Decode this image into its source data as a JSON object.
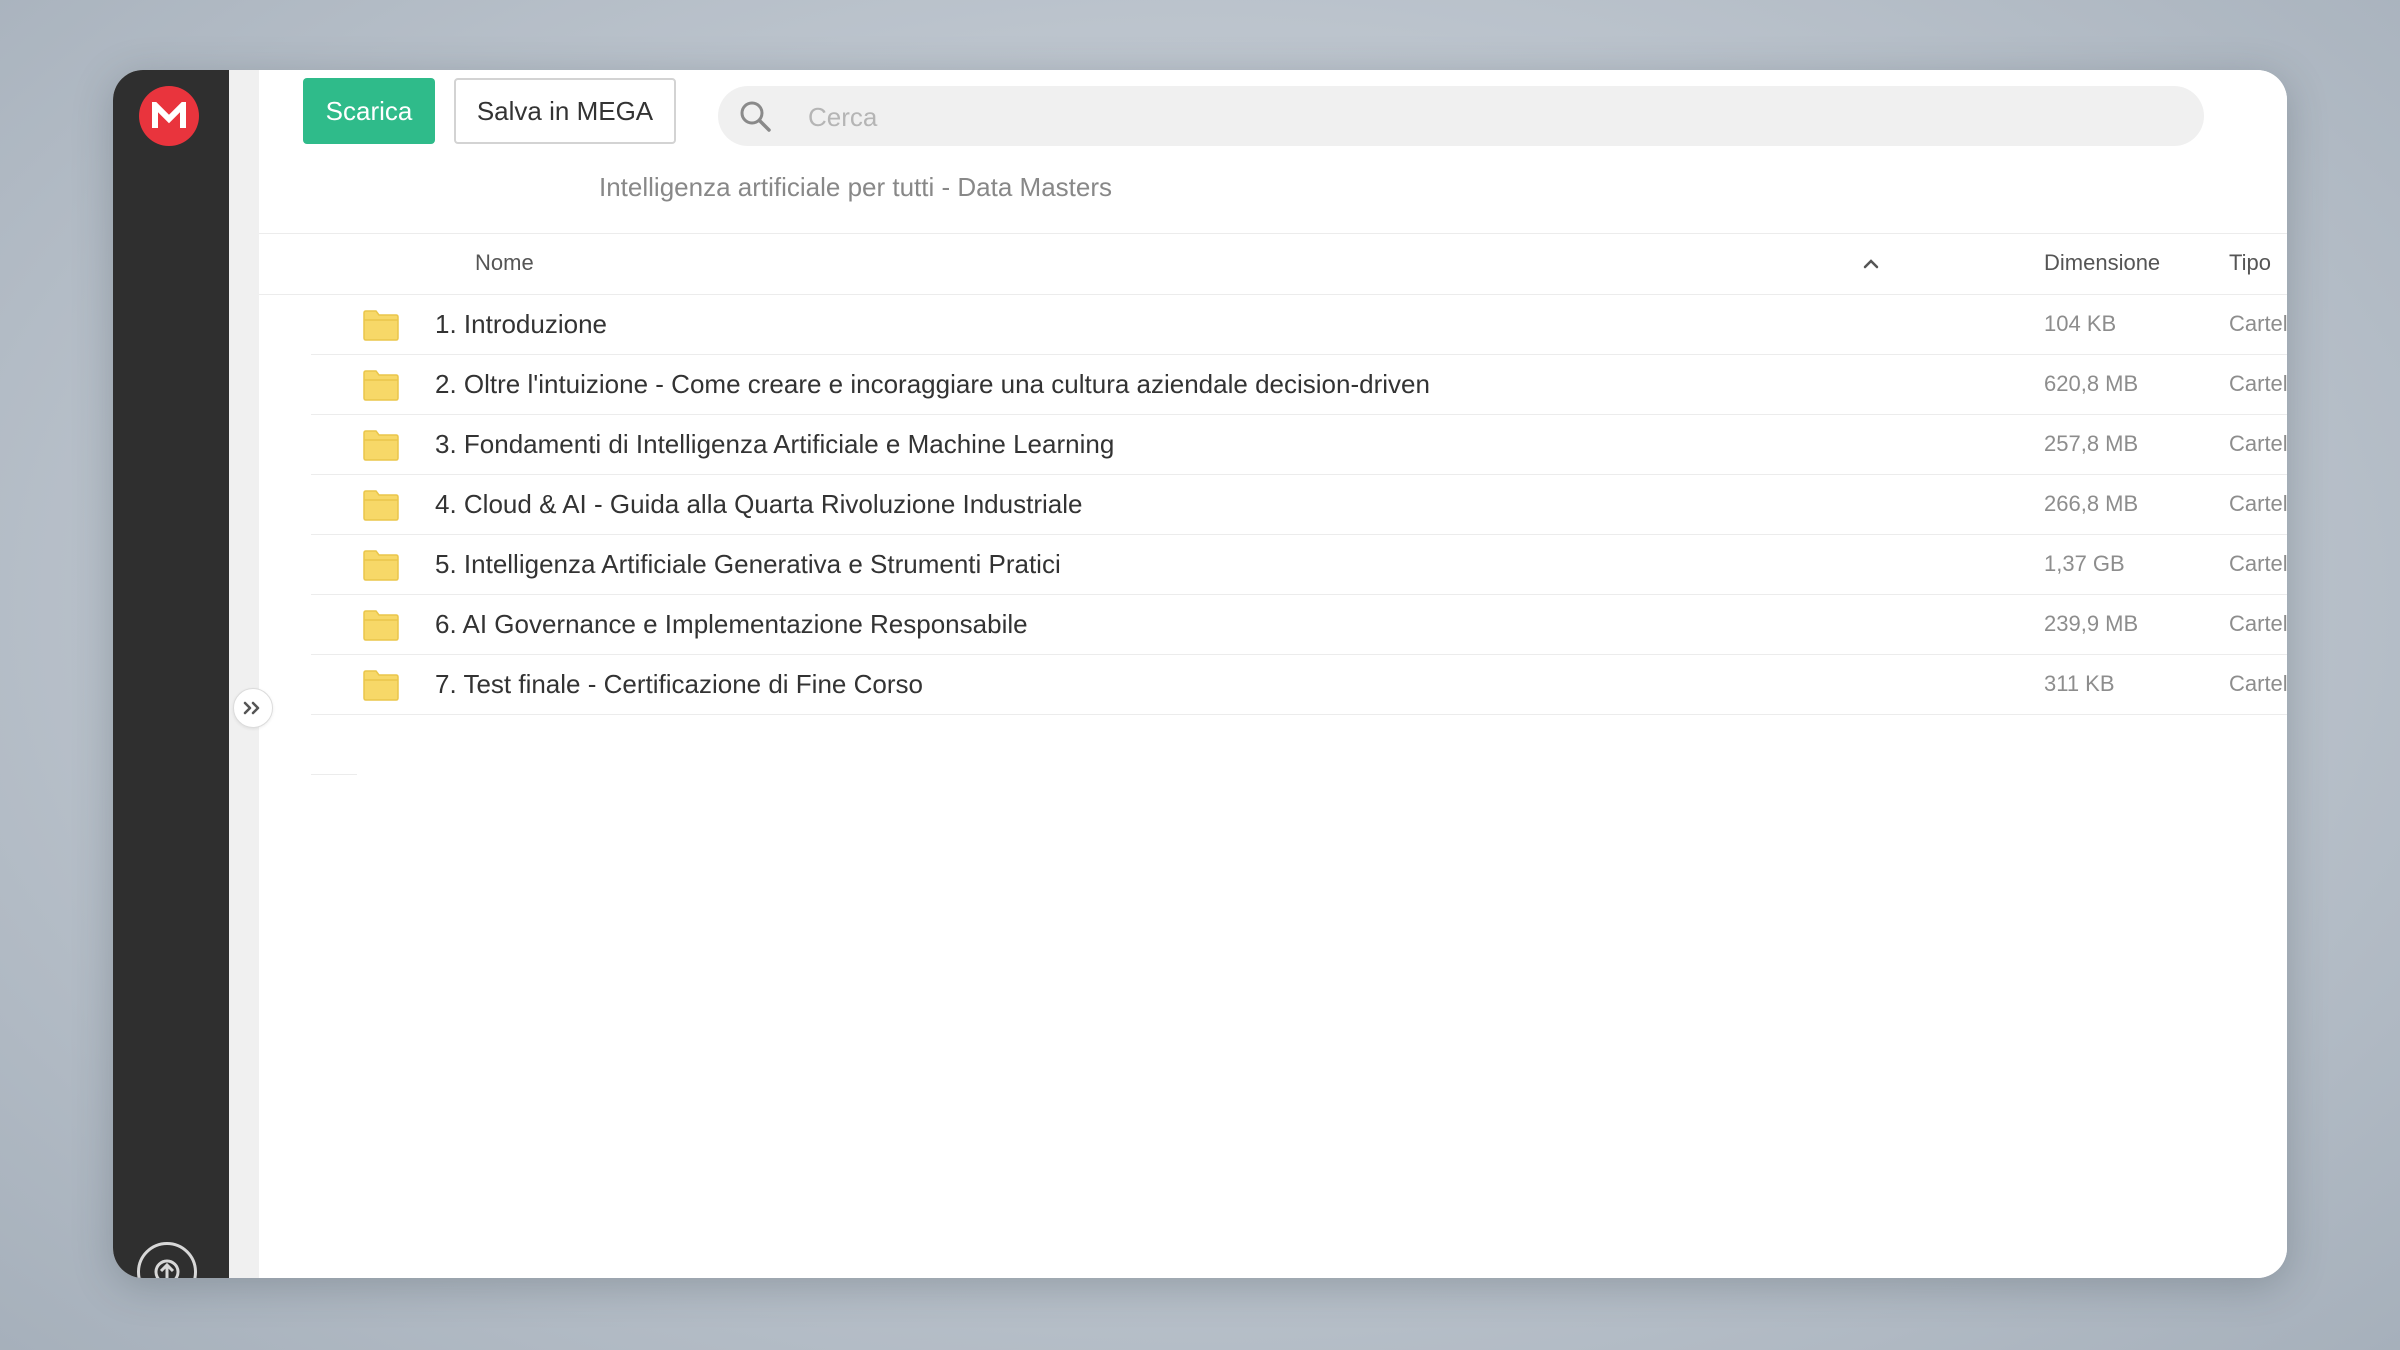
{
  "toolbar": {
    "download_label": "Scarica",
    "save_label": "Salva in MEGA"
  },
  "search": {
    "placeholder": "Cerca",
    "value": ""
  },
  "breadcrumb": "Intelligenza artificiale per tutti - Data Masters",
  "table": {
    "columns": {
      "name": "Nome",
      "size": "Dimensione",
      "type": "Tipo"
    },
    "sort": "ascending",
    "rows": [
      {
        "name": "1. Introduzione",
        "size": "104 KB",
        "type": "Cartella"
      },
      {
        "name": "2. Oltre l'intuizione - Come creare e incoraggiare una cultura aziendale decision-driven",
        "size": "620,8 MB",
        "type": "Cartella"
      },
      {
        "name": "3. Fondamenti di Intelligenza Artificiale e Machine Learning",
        "size": "257,8 MB",
        "type": "Cartella"
      },
      {
        "name": "4. Cloud & AI - Guida alla Quarta Rivoluzione Industriale",
        "size": "266,8 MB",
        "type": "Cartella"
      },
      {
        "name": "5. Intelligenza Artificiale Generativa e Strumenti Pratici",
        "size": "1,37 GB",
        "type": "Cartella"
      },
      {
        "name": "6. AI Governance e Implementazione Responsabile",
        "size": "239,9 MB",
        "type": "Cartella"
      },
      {
        "name": "7. Test finale - Certificazione di Fine Corso",
        "size": "311 KB",
        "type": "Cartella"
      }
    ]
  },
  "icons": {
    "logo": "mega-logo-icon",
    "search": "search-icon",
    "folder": "folder-icon",
    "sort": "chevron-up-icon",
    "expand": "double-chevron-right-icon",
    "transfers": "upload-icon"
  },
  "colors": {
    "brand_red": "#e9343d",
    "download_green": "#2fbb8a",
    "sidebar": "#2f2f2f",
    "folder_yellow": "#f7d868"
  }
}
